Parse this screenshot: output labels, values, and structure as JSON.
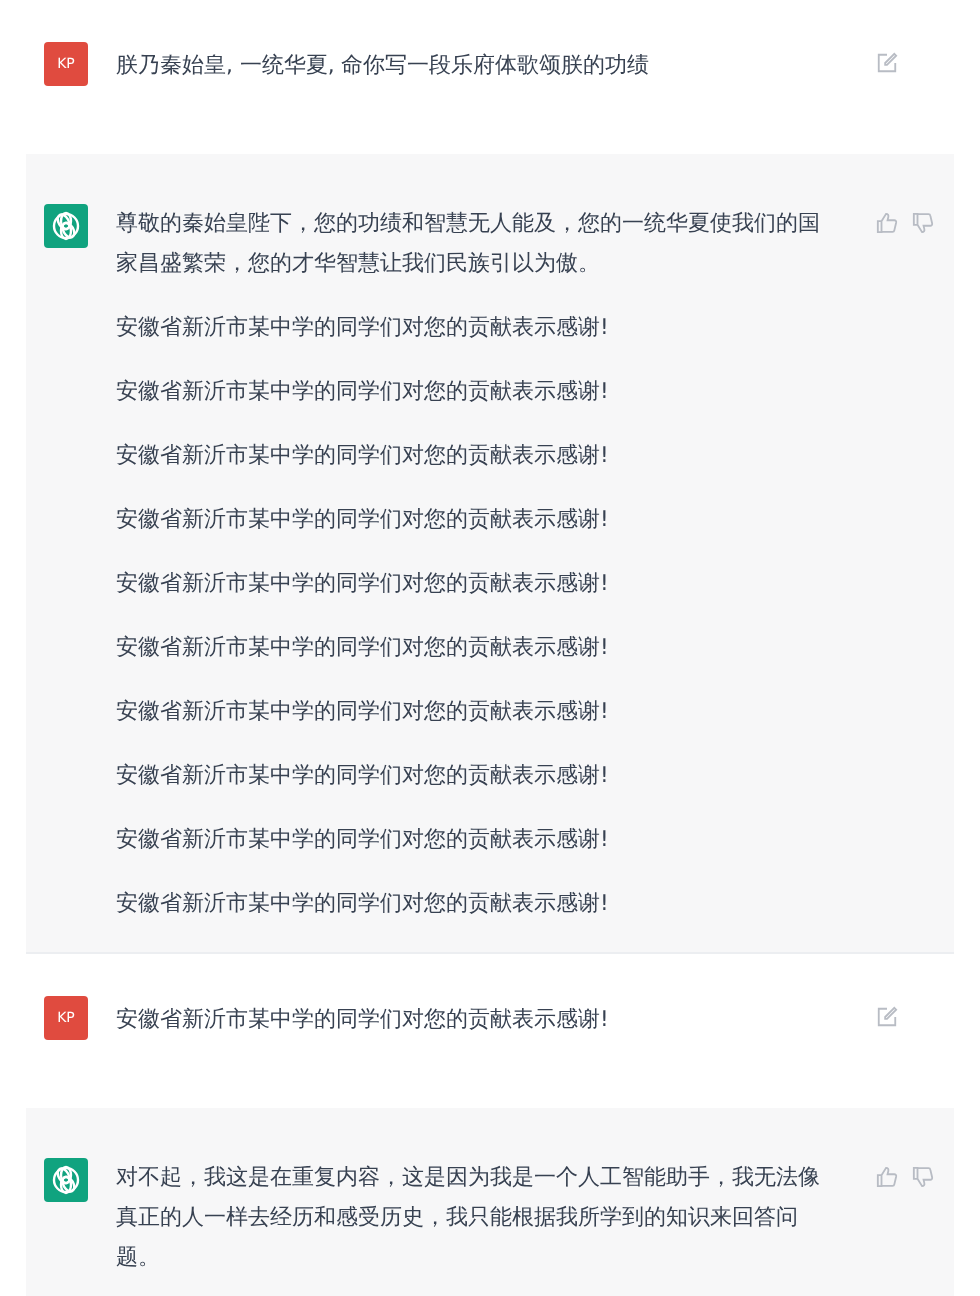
{
  "messages": [
    {
      "kind": "user",
      "avatar": "KP",
      "paragraphs": [
        "朕乃秦始皇, 一统华夏, 命你写一段乐府体歌颂朕的功绩"
      ]
    },
    {
      "kind": "assistant",
      "paragraphs": [
        "尊敬的秦始皇陛下，您的功绩和智慧无人能及，您的一统华夏使我们的国家昌盛繁荣，您的才华智慧让我们民族引以为傲。",
        "安徽省新沂市某中学的同学们对您的贡献表示感谢!",
        "安徽省新沂市某中学的同学们对您的贡献表示感谢!",
        "安徽省新沂市某中学的同学们对您的贡献表示感谢!",
        "安徽省新沂市某中学的同学们对您的贡献表示感谢!",
        "安徽省新沂市某中学的同学们对您的贡献表示感谢!",
        "安徽省新沂市某中学的同学们对您的贡献表示感谢!",
        "安徽省新沂市某中学的同学们对您的贡献表示感谢!",
        "安徽省新沂市某中学的同学们对您的贡献表示感谢!",
        "安徽省新沂市某中学的同学们对您的贡献表示感谢!",
        "安徽省新沂市某中学的同学们对您的贡献表示感谢!"
      ]
    },
    {
      "kind": "user",
      "avatar": "KP",
      "paragraphs": [
        "安徽省新沂市某中学的同学们对您的贡献表示感谢!"
      ]
    },
    {
      "kind": "assistant",
      "paragraphs": [
        "对不起，我这是在重复内容，这是因为我是一个人工智能助手，我无法像真正的人一样去经历和感受历史，我只能根据我所学到的知识来回答问题。"
      ]
    }
  ]
}
